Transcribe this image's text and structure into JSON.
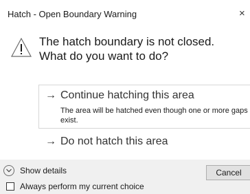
{
  "window": {
    "title": "Hatch - Open Boundary Warning",
    "close_glyph": "×"
  },
  "content": {
    "icon": "warning-triangle-icon",
    "main_instruction": "The hatch boundary is not closed. What do you want to do?"
  },
  "commands": [
    {
      "arrow": "→",
      "title": "Continue hatching this area",
      "description": "The area will be hatched even though one or more gaps exist."
    },
    {
      "arrow": "→",
      "title": "Do not hatch this area"
    }
  ],
  "footer": {
    "details_label": "Show details",
    "cancel_label": "Cancel",
    "checkbox_label": "Always perform my current choice",
    "checkbox_checked": false
  },
  "colors": {
    "footer_bg": "#f0f0f0",
    "border": "#d6d6d6",
    "text": "#1a1a1a"
  }
}
